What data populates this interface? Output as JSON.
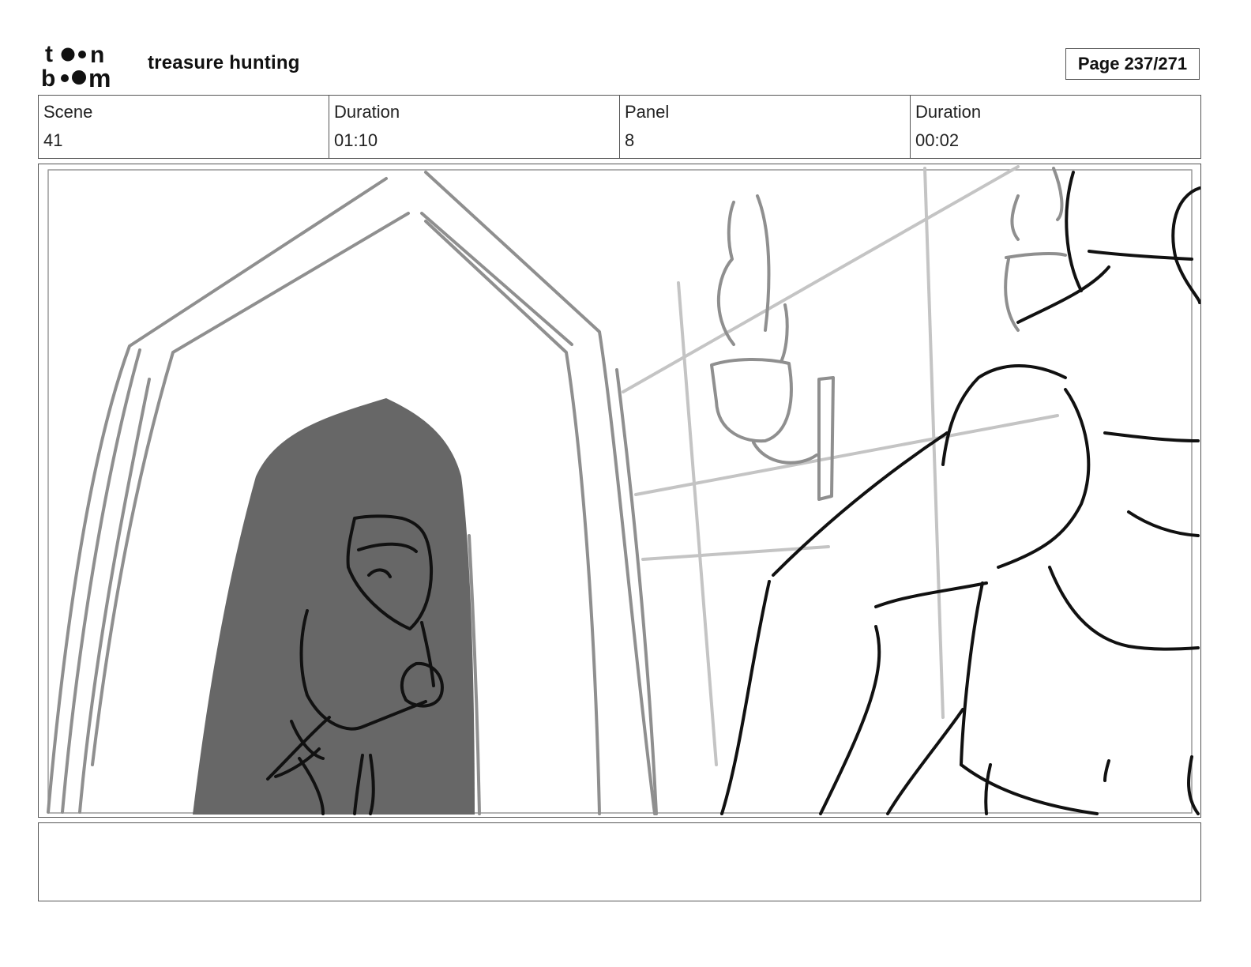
{
  "header": {
    "logo_text": "toon boom",
    "project_title": "treasure hunting",
    "page_label": "Page 237/271"
  },
  "info": {
    "scene_label": "Scene",
    "scene_value": "41",
    "scene_duration_label": "Duration",
    "scene_duration_value": "01:10",
    "panel_label": "Panel",
    "panel_value": "8",
    "panel_duration_label": "Duration",
    "panel_duration_value": "00:02"
  },
  "notes": {
    "text": ""
  },
  "colors": {
    "sketch_dark": "#111111",
    "sketch_mid": "#8f8f8f",
    "sketch_light": "#c4c4c4",
    "shadow_fill": "#676767",
    "frame_border": "#555555"
  }
}
